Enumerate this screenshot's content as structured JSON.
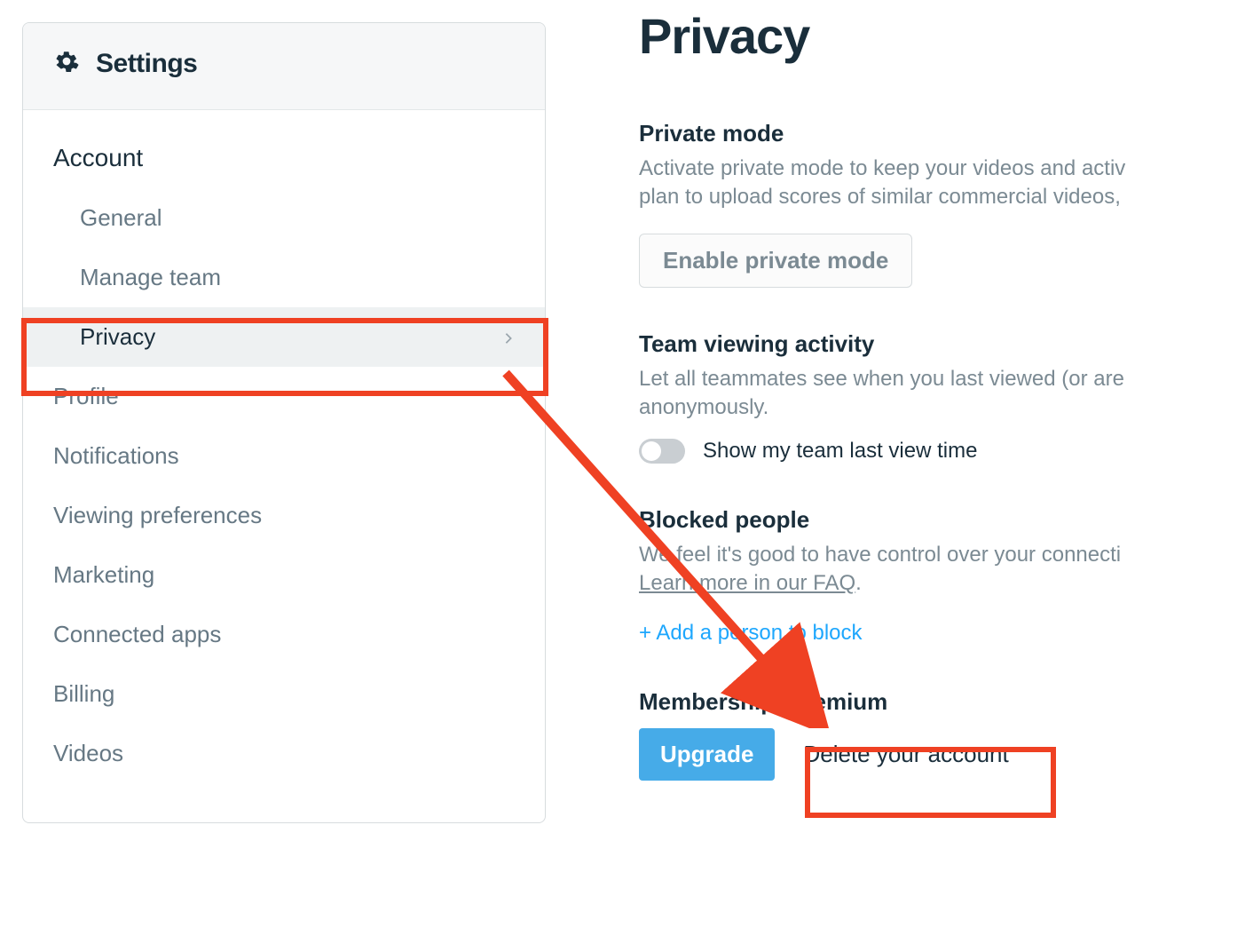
{
  "sidebar": {
    "title": "Settings",
    "section": "Account",
    "items": [
      {
        "label": "General"
      },
      {
        "label": "Manage team"
      },
      {
        "label": "Privacy",
        "selected": true
      }
    ],
    "root_items": [
      {
        "label": "Profile"
      },
      {
        "label": "Notifications"
      },
      {
        "label": "Viewing preferences"
      },
      {
        "label": "Marketing"
      },
      {
        "label": "Connected apps"
      },
      {
        "label": "Billing"
      },
      {
        "label": "Videos"
      }
    ]
  },
  "main": {
    "title": "Privacy",
    "private_mode": {
      "heading": "Private mode",
      "desc_line1": "Activate private mode to keep your videos and activ",
      "desc_line2": "plan to upload scores of similar commercial videos,",
      "button": "Enable private mode"
    },
    "team_activity": {
      "heading": "Team viewing activity",
      "desc_line1": "Let all teammates see when you last viewed (or are",
      "desc_line2": "anonymously.",
      "toggle_label": "Show my team last view time"
    },
    "blocked": {
      "heading": "Blocked people",
      "desc": "We feel it's good to have control over your connecti",
      "faq": "Learn more in our FAQ",
      "add": "+ Add a person to block"
    },
    "membership": {
      "heading": "Membership: Premium",
      "upgrade": "Upgrade",
      "delete": "Delete your account"
    }
  }
}
